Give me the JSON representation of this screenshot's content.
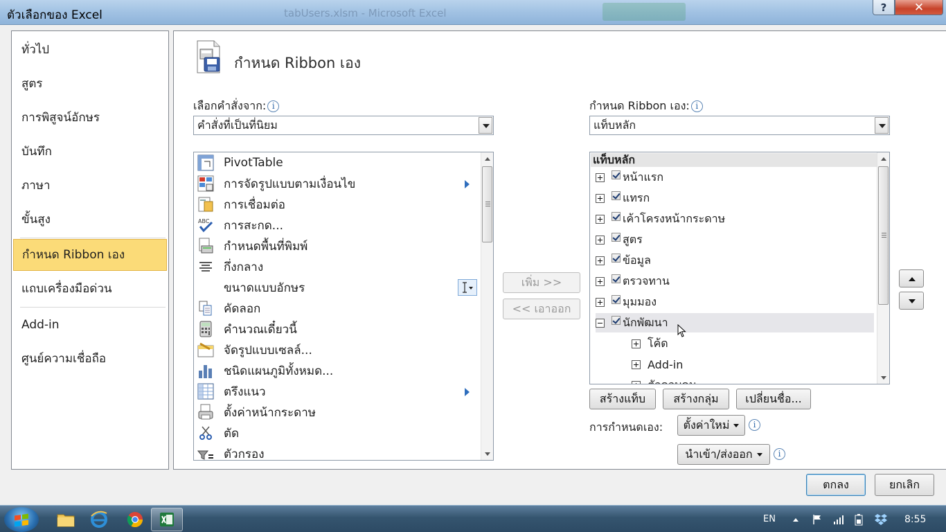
{
  "window": {
    "title": "ตัวเลือกของ Excel",
    "background_title": "tabUsers.xlsm - Microsoft Excel",
    "help_glyph": "?",
    "close_glyph": "✕"
  },
  "nav": {
    "items": [
      {
        "label": "ทั่วไป"
      },
      {
        "label": "สูตร"
      },
      {
        "label": "การพิสูจน์อักษร"
      },
      {
        "label": "บันทึก"
      },
      {
        "label": "ภาษา"
      },
      {
        "label": "ขั้นสูง"
      },
      {
        "label": "กำหนด Ribbon เอง",
        "selected": true
      },
      {
        "label": "แถบเครื่องมือด่วน"
      },
      {
        "label": "Add-in"
      },
      {
        "label": "ศูนย์ความเชื่อถือ"
      }
    ]
  },
  "header": {
    "title": "กำหนด Ribbon เอง"
  },
  "left": {
    "label": "เลือกคำสั่งจาก:",
    "info": "i",
    "combo_value": "คำสั่งที่เป็นที่นิยม",
    "commands": [
      {
        "label": "PivotTable",
        "icon": "pivottable-icon"
      },
      {
        "label": "การจัดรูปแบบตามเงื่อนไข",
        "icon": "conditional-format-icon",
        "submenu": true
      },
      {
        "label": "การเชื่อมต่อ",
        "icon": "connections-icon"
      },
      {
        "label": "การสะกด...",
        "icon": "spelling-icon"
      },
      {
        "label": "กำหนดพื้นที่พิมพ์",
        "icon": "print-area-icon"
      },
      {
        "label": "กึ่งกลาง",
        "icon": "center-align-icon"
      },
      {
        "label": "ขนาดแบบอักษร",
        "icon": "font-size-icon"
      },
      {
        "label": "คัดลอก",
        "icon": "copy-icon"
      },
      {
        "label": "คำนวณเดี๋ยวนี้",
        "icon": "calculator-icon"
      },
      {
        "label": "จัดรูปแบบเซลล์...",
        "icon": "format-cells-icon"
      },
      {
        "label": "ชนิดแผนภูมิทั้งหมด...",
        "icon": "chart-icon"
      },
      {
        "label": "ตรึงแนว",
        "icon": "freeze-panes-icon",
        "submenu": true
      },
      {
        "label": "ตั้งค่าหน้ากระดาษ",
        "icon": "page-setup-icon"
      },
      {
        "label": "ตัด",
        "icon": "scissors-icon"
      },
      {
        "label": "ตัวกรอง",
        "icon": "filter-icon"
      }
    ]
  },
  "middle": {
    "add_label": "เพิ่ม >>",
    "remove_label": "<< เอาออก"
  },
  "right": {
    "label": "กำหนด Ribbon เอง:",
    "info": "i",
    "combo_value": "แท็บหลัก",
    "tree_header": "แท็บหลัก",
    "tabs": [
      {
        "label": "หน้าแรก",
        "checked": true,
        "expanded": false
      },
      {
        "label": "แทรก",
        "checked": true,
        "expanded": false
      },
      {
        "label": "เค้าโครงหน้ากระดาษ",
        "checked": true,
        "expanded": false
      },
      {
        "label": "สูตร",
        "checked": true,
        "expanded": false
      },
      {
        "label": "ข้อมูล",
        "checked": true,
        "expanded": false
      },
      {
        "label": "ตรวจทาน",
        "checked": true,
        "expanded": false
      },
      {
        "label": "มุมมอง",
        "checked": true,
        "expanded": false
      },
      {
        "label": "นักพัฒนา",
        "checked": true,
        "expanded": true
      }
    ],
    "developer_groups": [
      {
        "label": "โค้ด"
      },
      {
        "label": "Add-in"
      },
      {
        "label": "ตัวควบคุม"
      }
    ],
    "new_tab_label": "สร้างแท็บ",
    "new_group_label": "สร้างกลุ่ม",
    "rename_label": "เปลี่ยนชื่อ...",
    "customizations_label": "การกำหนดเอง:",
    "reset_label": "ตั้งค่าใหม่",
    "import_export_label": "นำเข้า/ส่งออก"
  },
  "footer": {
    "ok_label": "ตกลง",
    "cancel_label": "ยกเลิก"
  },
  "taskbar": {
    "apps": [
      {
        "name": "explorer-icon"
      },
      {
        "name": "internet-explorer-icon"
      },
      {
        "name": "chrome-icon"
      },
      {
        "name": "excel-icon",
        "active": true
      }
    ],
    "language": "EN",
    "clock": "8:55"
  }
}
